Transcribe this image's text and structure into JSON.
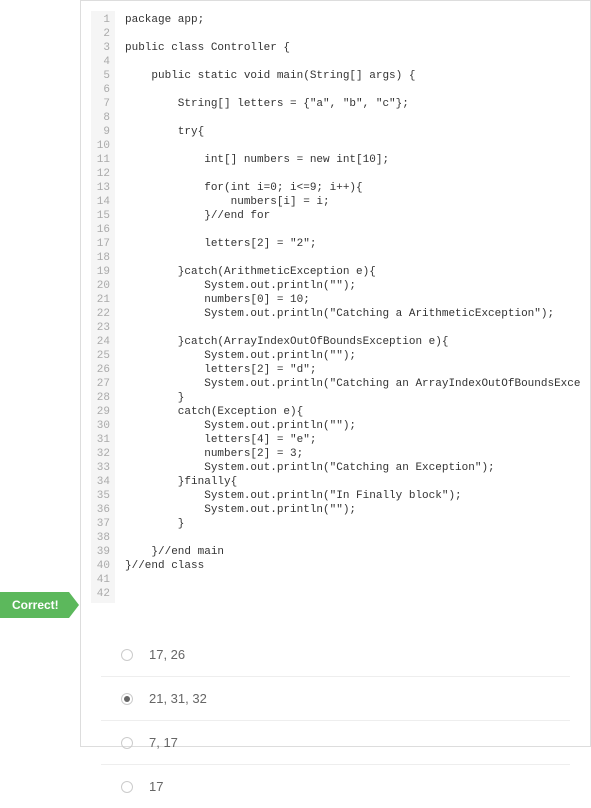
{
  "code": {
    "lines": [
      "package app;",
      "",
      "public class Controller {",
      "",
      "    public static void main(String[] args) {",
      "",
      "        String[] letters = {\"a\", \"b\", \"c\"};",
      "",
      "        try{",
      "",
      "            int[] numbers = new int[10];",
      "",
      "            for(int i=0; i<=9; i++){",
      "                numbers[i] = i;",
      "            }//end for",
      "",
      "            letters[2] = \"2\";",
      "",
      "        }catch(ArithmeticException e){",
      "            System.out.println(\"\");",
      "            numbers[0] = 10;",
      "            System.out.println(\"Catching a ArithmeticException\");",
      "",
      "        }catch(ArrayIndexOutOfBoundsException e){",
      "            System.out.println(\"\");",
      "            letters[2] = \"d\";",
      "            System.out.println(\"Catching an ArrayIndexOutOfBoundsException\");",
      "        }",
      "        catch(Exception e){",
      "            System.out.println(\"\");",
      "            letters[4] = \"e\";",
      "            numbers[2] = 3;",
      "            System.out.println(\"Catching an Exception\");",
      "        }finally{",
      "            System.out.println(\"In Finally block\");",
      "            System.out.println(\"\");",
      "        }",
      "",
      "    }//end main",
      "}//end class",
      "",
      ""
    ]
  },
  "answers": {
    "options": [
      {
        "label": "17, 26",
        "selected": false
      },
      {
        "label": "21, 31, 32",
        "selected": true
      },
      {
        "label": "7, 17",
        "selected": false
      },
      {
        "label": "17",
        "selected": false
      }
    ]
  },
  "feedback": {
    "correct_label": "Correct!"
  }
}
